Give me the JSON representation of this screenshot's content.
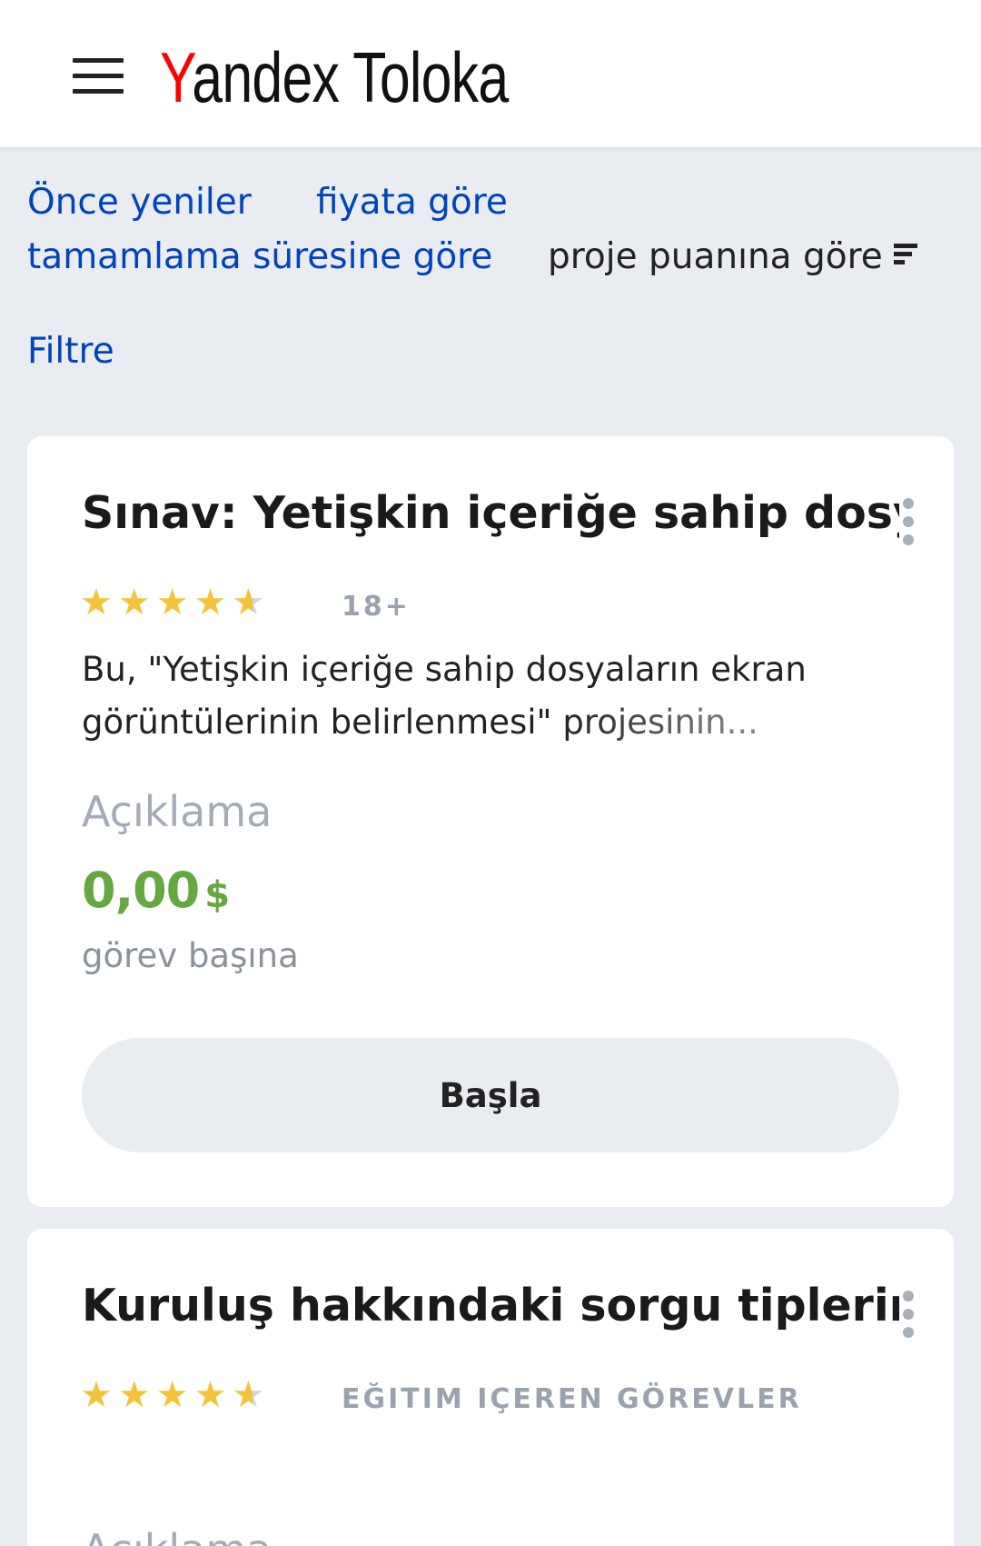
{
  "header": {
    "logo_y": "Y",
    "logo_andex": "andex",
    "logo_toloka": "Toloka"
  },
  "sort": {
    "newest": "Önce yeniler",
    "price": "fiyata göre",
    "completion_time": "tamamlama süresine göre",
    "project_rating": "proje puanına göre"
  },
  "filter_label": "Filtre",
  "cards": [
    {
      "title": "Sınav: Yetişkin içeriğe sahip dosy...",
      "rating": 4.5,
      "badge": "18+",
      "description_line1": "Bu, \"Yetişkin içeriğe sahip dosyaların ekran",
      "description_line2": "görüntülerinin belirlenmesi\" projesinin...",
      "description_link": "Açıklama",
      "price": "0,00",
      "currency": "$",
      "price_unit": "görev başına",
      "start_label": "Başla"
    },
    {
      "title": "Kuruluş hakkındaki sorgu tiplerini..",
      "rating": 4.5,
      "badge": "EĞITIM IÇEREN GÖREVLER",
      "description_link": "Açıklama"
    }
  ],
  "colors": {
    "link": "#0044bb",
    "price_green": "#65a741",
    "star": "#f5c33b",
    "logo_red": "#ff0000"
  }
}
